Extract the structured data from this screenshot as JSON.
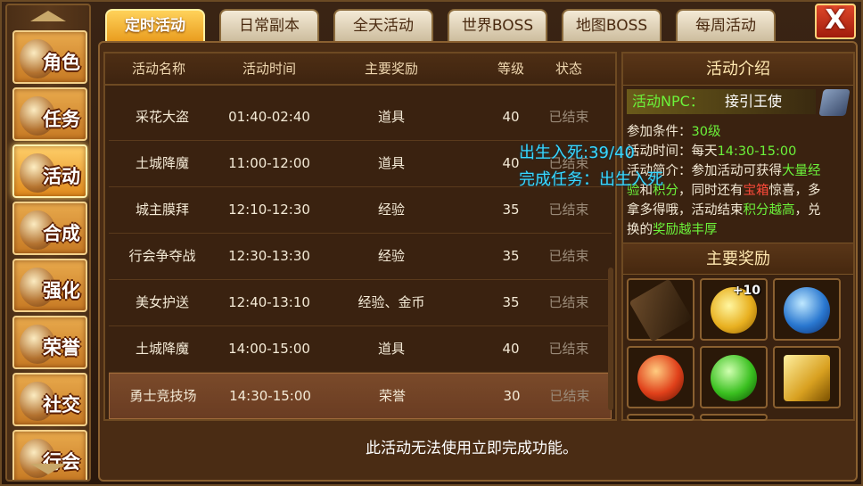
{
  "tabs": [
    {
      "label": "定时活动",
      "active": true
    },
    {
      "label": "日常副本",
      "active": false
    },
    {
      "label": "全天活动",
      "active": false
    },
    {
      "label": "世界BOSS",
      "active": false
    },
    {
      "label": "地图BOSS",
      "active": false
    },
    {
      "label": "每周活动",
      "active": false
    }
  ],
  "close_label": "X",
  "sidebar": {
    "items": [
      {
        "label": "角色"
      },
      {
        "label": "任务"
      },
      {
        "label": "活动",
        "active": true
      },
      {
        "label": "合成"
      },
      {
        "label": "强化"
      },
      {
        "label": "荣誉"
      },
      {
        "label": "社交"
      },
      {
        "label": "行会"
      }
    ]
  },
  "list": {
    "headers": [
      "活动名称",
      "活动时间",
      "主要奖励",
      "等级",
      "状态"
    ],
    "rows": [
      {
        "name": "采花大盗",
        "time": "01:40-02:40",
        "reward": "道具",
        "level": "40",
        "status": "已结束"
      },
      {
        "name": "土城降魔",
        "time": "11:00-12:00",
        "reward": "道具",
        "level": "40",
        "status": "已结束"
      },
      {
        "name": "城主膜拜",
        "time": "12:10-12:30",
        "reward": "经验",
        "level": "35",
        "status": "已结束"
      },
      {
        "name": "行会争夺战",
        "time": "12:30-13:30",
        "reward": "经验",
        "level": "35",
        "status": "已结束"
      },
      {
        "name": "美女护送",
        "time": "12:40-13:10",
        "reward": "经验、金币",
        "level": "35",
        "status": "已结束"
      },
      {
        "name": "土城降魔",
        "time": "14:00-15:00",
        "reward": "道具",
        "level": "40",
        "status": "已结束"
      },
      {
        "name": "勇士竞技场",
        "time": "14:30-15:00",
        "reward": "荣誉",
        "level": "30",
        "status": "已结束",
        "selected": true
      }
    ]
  },
  "info": {
    "title": "活动介绍",
    "npc_label": "活动NPC：",
    "npc_name": "接引王使",
    "req_label": "参加条件：",
    "req_value": "30级",
    "time_label": "活动时间：每天",
    "time_value": "14:30-15:00",
    "desc_line1_a": "活动简介：参加活动可获得",
    "desc_line1_b": "大量经",
    "desc_line2_a": "验",
    "desc_line2_b": "和",
    "desc_line2_c": "积分",
    "desc_line2_d": "，同时还有",
    "desc_line2_e": "宝箱",
    "desc_line2_f": "惊喜，多",
    "desc_line3": "拿多得哦，活动结束",
    "desc_line3_b": "积分越高",
    "desc_line3_c": "，兑",
    "desc_line4_a": "换的",
    "desc_line4_b": "奖励越丰厚"
  },
  "rewards": {
    "title": "主要奖励",
    "slots": [
      {
        "icon": "scroll-item-icon",
        "count": ""
      },
      {
        "icon": "gold-ingot-icon",
        "count": "+10"
      },
      {
        "icon": "blue-orb-icon",
        "count": ""
      },
      {
        "icon": "red-orb-icon",
        "count": ""
      },
      {
        "icon": "green-gem-icon",
        "count": ""
      },
      {
        "icon": "gold-bars-icon",
        "count": ""
      }
    ]
  },
  "footer_note": "此活动无法使用立即完成功能。",
  "overlay": {
    "line1": "出生入死:39/40",
    "line2": "完成任务：出生入死"
  },
  "colors": {
    "accent_orange": "#e89a1c",
    "npc_green": "#6cf23a",
    "highlight_red": "#ff4a3a",
    "overlay_cyan": "#38d8ff"
  }
}
